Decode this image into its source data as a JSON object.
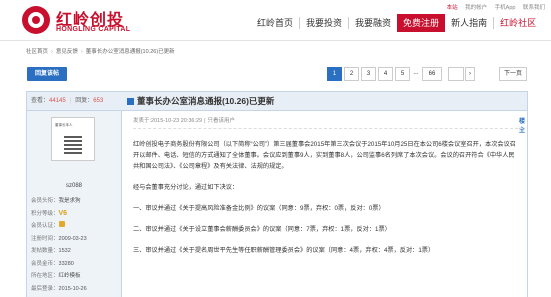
{
  "header": {
    "logo_cn": "红岭创投",
    "logo_en": "HONGLING CAPITAL",
    "topbar": [
      "本站",
      "我的帐户",
      "手机App",
      "联系我们"
    ],
    "nav": [
      "红岭首页",
      "我要投资",
      "我要融资",
      "免费注册",
      "新人指南",
      "红岭社区"
    ]
  },
  "breadcrumb": [
    "社区首页",
    "意见反馈",
    "董事长办公室消息通报(10.26)已更新"
  ],
  "toolbar": {
    "reply_label": "回复该帖",
    "pages": [
      "1",
      "2",
      "3",
      "4",
      "5",
      "...",
      "66"
    ],
    "next_label": "下一页"
  },
  "post": {
    "views_label": "查看：",
    "views": "44145",
    "replies_label": "回复：",
    "replies": "653",
    "title": "董事长办公室消息通报(10.26)已更新",
    "author": "sz088",
    "meta_time": "发表于:2015-10-23 20:36:29",
    "meta_link": "只看该用户",
    "floor": "楼主",
    "avatar_caption": "董事长本人",
    "user_info": [
      {
        "label": "会员头衔：",
        "value": "我是求狗"
      },
      {
        "label": "积分等级：",
        "value": "V6"
      },
      {
        "label": "会员认证：",
        "value": ""
      },
      {
        "label": "注册时间：",
        "value": "2009-03-23"
      },
      {
        "label": "发帖数量：",
        "value": "1532"
      },
      {
        "label": "会员金币：",
        "value": "33280"
      },
      {
        "label": "所在地区：",
        "value": "红岭模板"
      },
      {
        "label": "最后登录：",
        "value": "2015-10-26"
      }
    ],
    "content": [
      "红岭创投电子商务股份有限公司（以下简称“公司”）第三届董事会2015年第三次会议于2015年10月25日在本公司6楼会议室召开，本次会议召开以邮件、电话、短信的方式通知了全体董事。会议应到董事9人，实到董事8人，公司监事6名列席了本次会议。会议的召开符合《中华人民共和国公司法》、《公司章程》及有关法律、法规的规定。",
      "经与会董事充分讨论，通过如下决议：",
      "一、审议并通过《关于提高风险准备金比例》的议案（同意：9票，弃权：0票，反对：0票）",
      "二、审议并通过《关于设立董事会薪酬委员会》的议案（同意：7票，弃权：1票，反对：1票）",
      "三、审议并通过《关于提名周世平先生等任职薪酬管理委员会》的议案（同意：4票，弃权：4票，反对：1票）"
    ]
  }
}
